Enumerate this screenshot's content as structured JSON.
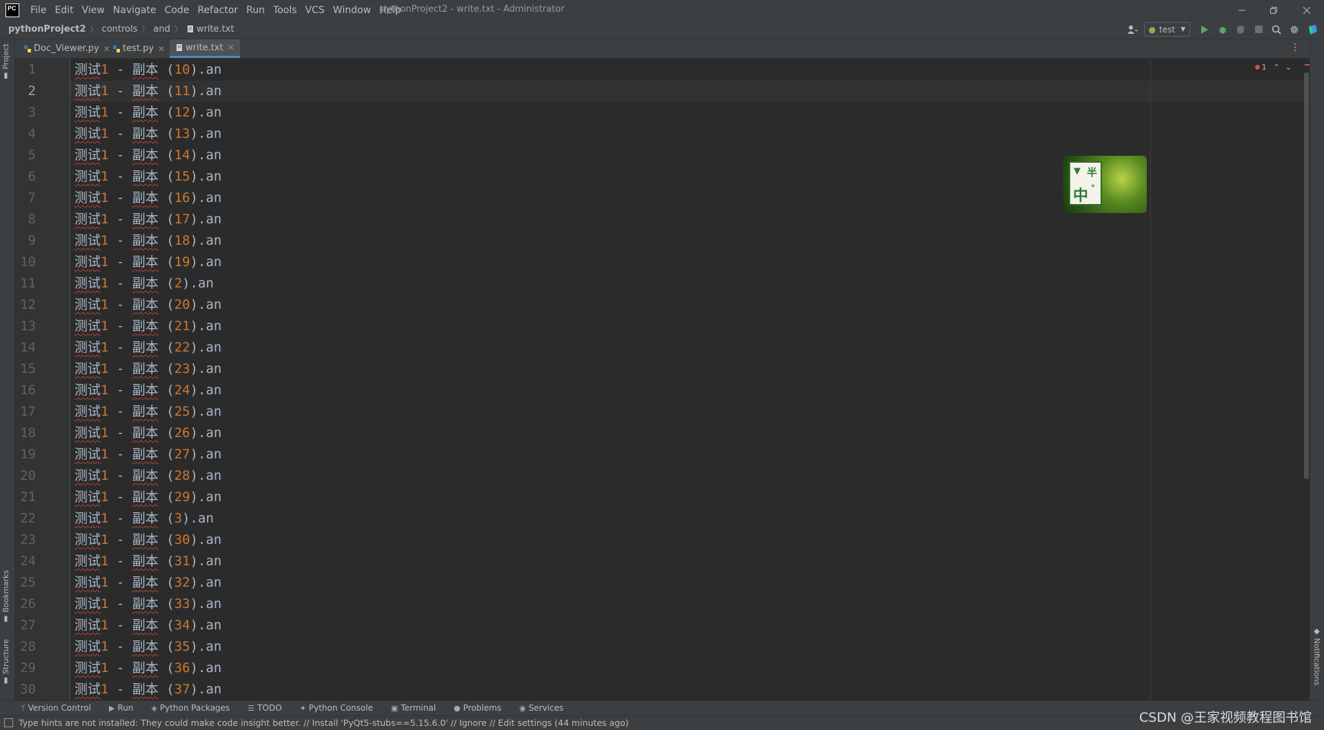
{
  "window": {
    "title": "pythonProject2 - write.txt - Administrator",
    "logo": "PC",
    "menus": [
      "File",
      "Edit",
      "View",
      "Navigate",
      "Code",
      "Refactor",
      "Run",
      "Tools",
      "VCS",
      "Window",
      "Help"
    ]
  },
  "breadcrumb": {
    "root": "pythonProject2",
    "items": [
      "controls",
      "and"
    ],
    "file": "write.txt"
  },
  "run_config": {
    "name": "test"
  },
  "tabs": [
    {
      "label": "Doc_Viewer.py",
      "active": false
    },
    {
      "label": "test.py",
      "active": false
    },
    {
      "label": "write.txt",
      "active": true
    }
  ],
  "left_tool_tabs": {
    "project": "Project",
    "bookmarks": "Bookmarks",
    "structure": "Structure"
  },
  "right_tool_tabs": {
    "notifications": "Notifications"
  },
  "editor": {
    "current_line": 2,
    "error_count": "1",
    "lines": [
      {
        "n": "1",
        "cn": "测试",
        "num": "1",
        "mid": " - ",
        "cn2": "副本",
        "open": " (",
        "val": "10",
        "tail": ").an"
      },
      {
        "n": "2",
        "cn": "测试",
        "num": "1",
        "mid": " - ",
        "cn2": "副本",
        "open": " (",
        "val": "11",
        "tail": ").an"
      },
      {
        "n": "3",
        "cn": "测试",
        "num": "1",
        "mid": " - ",
        "cn2": "副本",
        "open": " (",
        "val": "12",
        "tail": ").an"
      },
      {
        "n": "4",
        "cn": "测试",
        "num": "1",
        "mid": " - ",
        "cn2": "副本",
        "open": " (",
        "val": "13",
        "tail": ").an"
      },
      {
        "n": "5",
        "cn": "测试",
        "num": "1",
        "mid": " - ",
        "cn2": "副本",
        "open": " (",
        "val": "14",
        "tail": ").an"
      },
      {
        "n": "6",
        "cn": "测试",
        "num": "1",
        "mid": " - ",
        "cn2": "副本",
        "open": " (",
        "val": "15",
        "tail": ").an"
      },
      {
        "n": "7",
        "cn": "测试",
        "num": "1",
        "mid": " - ",
        "cn2": "副本",
        "open": " (",
        "val": "16",
        "tail": ").an"
      },
      {
        "n": "8",
        "cn": "测试",
        "num": "1",
        "mid": " - ",
        "cn2": "副本",
        "open": " (",
        "val": "17",
        "tail": ").an"
      },
      {
        "n": "9",
        "cn": "测试",
        "num": "1",
        "mid": " - ",
        "cn2": "副本",
        "open": " (",
        "val": "18",
        "tail": ").an"
      },
      {
        "n": "10",
        "cn": "测试",
        "num": "1",
        "mid": " - ",
        "cn2": "副本",
        "open": " (",
        "val": "19",
        "tail": ").an"
      },
      {
        "n": "11",
        "cn": "测试",
        "num": "1",
        "mid": " - ",
        "cn2": "副本",
        "open": " (",
        "val": "2",
        "tail": ").an"
      },
      {
        "n": "12",
        "cn": "测试",
        "num": "1",
        "mid": " - ",
        "cn2": "副本",
        "open": " (",
        "val": "20",
        "tail": ").an"
      },
      {
        "n": "13",
        "cn": "测试",
        "num": "1",
        "mid": " - ",
        "cn2": "副本",
        "open": " (",
        "val": "21",
        "tail": ").an"
      },
      {
        "n": "14",
        "cn": "测试",
        "num": "1",
        "mid": " - ",
        "cn2": "副本",
        "open": " (",
        "val": "22",
        "tail": ").an"
      },
      {
        "n": "15",
        "cn": "测试",
        "num": "1",
        "mid": " - ",
        "cn2": "副本",
        "open": " (",
        "val": "23",
        "tail": ").an"
      },
      {
        "n": "16",
        "cn": "测试",
        "num": "1",
        "mid": " - ",
        "cn2": "副本",
        "open": " (",
        "val": "24",
        "tail": ").an"
      },
      {
        "n": "17",
        "cn": "测试",
        "num": "1",
        "mid": " - ",
        "cn2": "副本",
        "open": " (",
        "val": "25",
        "tail": ").an"
      },
      {
        "n": "18",
        "cn": "测试",
        "num": "1",
        "mid": " - ",
        "cn2": "副本",
        "open": " (",
        "val": "26",
        "tail": ").an"
      },
      {
        "n": "19",
        "cn": "测试",
        "num": "1",
        "mid": " - ",
        "cn2": "副本",
        "open": " (",
        "val": "27",
        "tail": ").an"
      },
      {
        "n": "20",
        "cn": "测试",
        "num": "1",
        "mid": " - ",
        "cn2": "副本",
        "open": " (",
        "val": "28",
        "tail": ").an"
      },
      {
        "n": "21",
        "cn": "测试",
        "num": "1",
        "mid": " - ",
        "cn2": "副本",
        "open": " (",
        "val": "29",
        "tail": ").an"
      },
      {
        "n": "22",
        "cn": "测试",
        "num": "1",
        "mid": " - ",
        "cn2": "副本",
        "open": " (",
        "val": "3",
        "tail": ").an"
      },
      {
        "n": "23",
        "cn": "测试",
        "num": "1",
        "mid": " - ",
        "cn2": "副本",
        "open": " (",
        "val": "30",
        "tail": ").an"
      },
      {
        "n": "24",
        "cn": "测试",
        "num": "1",
        "mid": " - ",
        "cn2": "副本",
        "open": " (",
        "val": "31",
        "tail": ").an"
      },
      {
        "n": "25",
        "cn": "测试",
        "num": "1",
        "mid": " - ",
        "cn2": "副本",
        "open": " (",
        "val": "32",
        "tail": ").an"
      },
      {
        "n": "26",
        "cn": "测试",
        "num": "1",
        "mid": " - ",
        "cn2": "副本",
        "open": " (",
        "val": "33",
        "tail": ").an"
      },
      {
        "n": "27",
        "cn": "测试",
        "num": "1",
        "mid": " - ",
        "cn2": "副本",
        "open": " (",
        "val": "34",
        "tail": ").an"
      },
      {
        "n": "28",
        "cn": "测试",
        "num": "1",
        "mid": " - ",
        "cn2": "副本",
        "open": " (",
        "val": "35",
        "tail": ").an"
      },
      {
        "n": "29",
        "cn": "测试",
        "num": "1",
        "mid": " - ",
        "cn2": "副本",
        "open": " (",
        "val": "36",
        "tail": ").an"
      },
      {
        "n": "30",
        "cn": "测试",
        "num": "1",
        "mid": " - ",
        "cn2": "副本",
        "open": " (",
        "val": "37",
        "tail": ").an"
      }
    ]
  },
  "thumbnail": {
    "line1": "半",
    "line2": "中",
    "mark": "°"
  },
  "tool_windows": [
    "Version Control",
    "Run",
    "Python Packages",
    "TODO",
    "Python Console",
    "Terminal",
    "Problems",
    "Services"
  ],
  "status": {
    "message": "Type hints are not installed: They could make code insight better. // Install 'PyQt5-stubs==5.15.6.0' // Ignore // Edit settings (44 minutes ago)"
  },
  "watermark": "CSDN @王家视频教程图书馆",
  "colors": {
    "editor_bg": "#2b2b2b",
    "number": "#cc7832",
    "text": "#a9b7c6",
    "error": "#c75450",
    "tab_accent": "#4a88c7"
  }
}
